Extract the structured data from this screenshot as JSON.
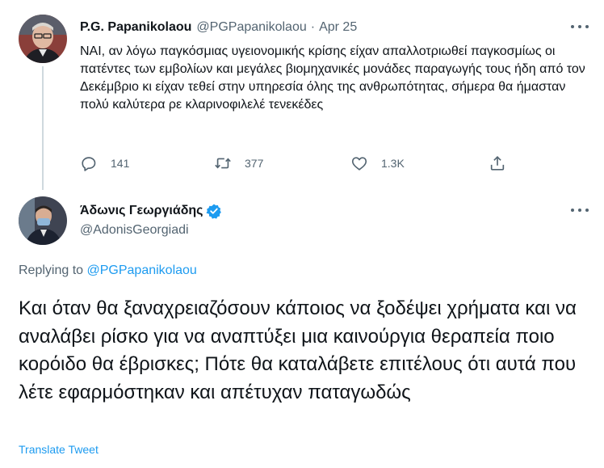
{
  "parent_tweet": {
    "author_name": "P.G. Papanikolaou",
    "author_handle": "@PGPapanikolaou",
    "separator": "·",
    "date": "Apr 25",
    "text": "ΝΑΙ, αν λόγω παγκόσμιας υγειονομικής κρίσης είχαν απαλλοτριωθεί παγκοσμίως οι πατέντες των εμβολίων και μεγάλες βιομηχανικές μονάδες παραγωγής τους ήδη από τον Δεκέμβριο κι είχαν τεθεί στην υπηρεσία όλης της ανθρωπότητας, σήμερα θα ήμασταν πολύ καλύτερα ρε κλαρινοφιλελέ τενεκέδες",
    "actions": {
      "reply_count": "141",
      "retweet_count": "377",
      "like_count": "1.3K"
    }
  },
  "main_tweet": {
    "author_name": "Άδωνις Γεωργιάδης",
    "author_handle": "@AdonisGeorgiadi",
    "replying_prefix": "Replying to",
    "replying_to": "@PGPapanikolaou",
    "text": "Και όταν θα ξαναχρειαζόσουν κάποιος να ξοδέψει χρήματα και να αναλάβει ρίσκο για να αναπτύξει μια καινούργια θεραπεία ποιο κορόιδο θα έβρισκες; Πότε θα καταλάβετε επιτέλους ότι αυτά που λέτε εφαρμόστηκαν και απέτυχαν παταγωδώς",
    "translate_label": "Translate Tweet"
  },
  "colors": {
    "accent": "#1d9bf0",
    "secondary_text": "#536471",
    "primary_text": "#0f1419",
    "thread_line": "#cfd9de"
  },
  "icons": [
    "reply-icon",
    "retweet-icon",
    "like-icon",
    "share-icon",
    "more-icon",
    "verified-badge-icon"
  ]
}
